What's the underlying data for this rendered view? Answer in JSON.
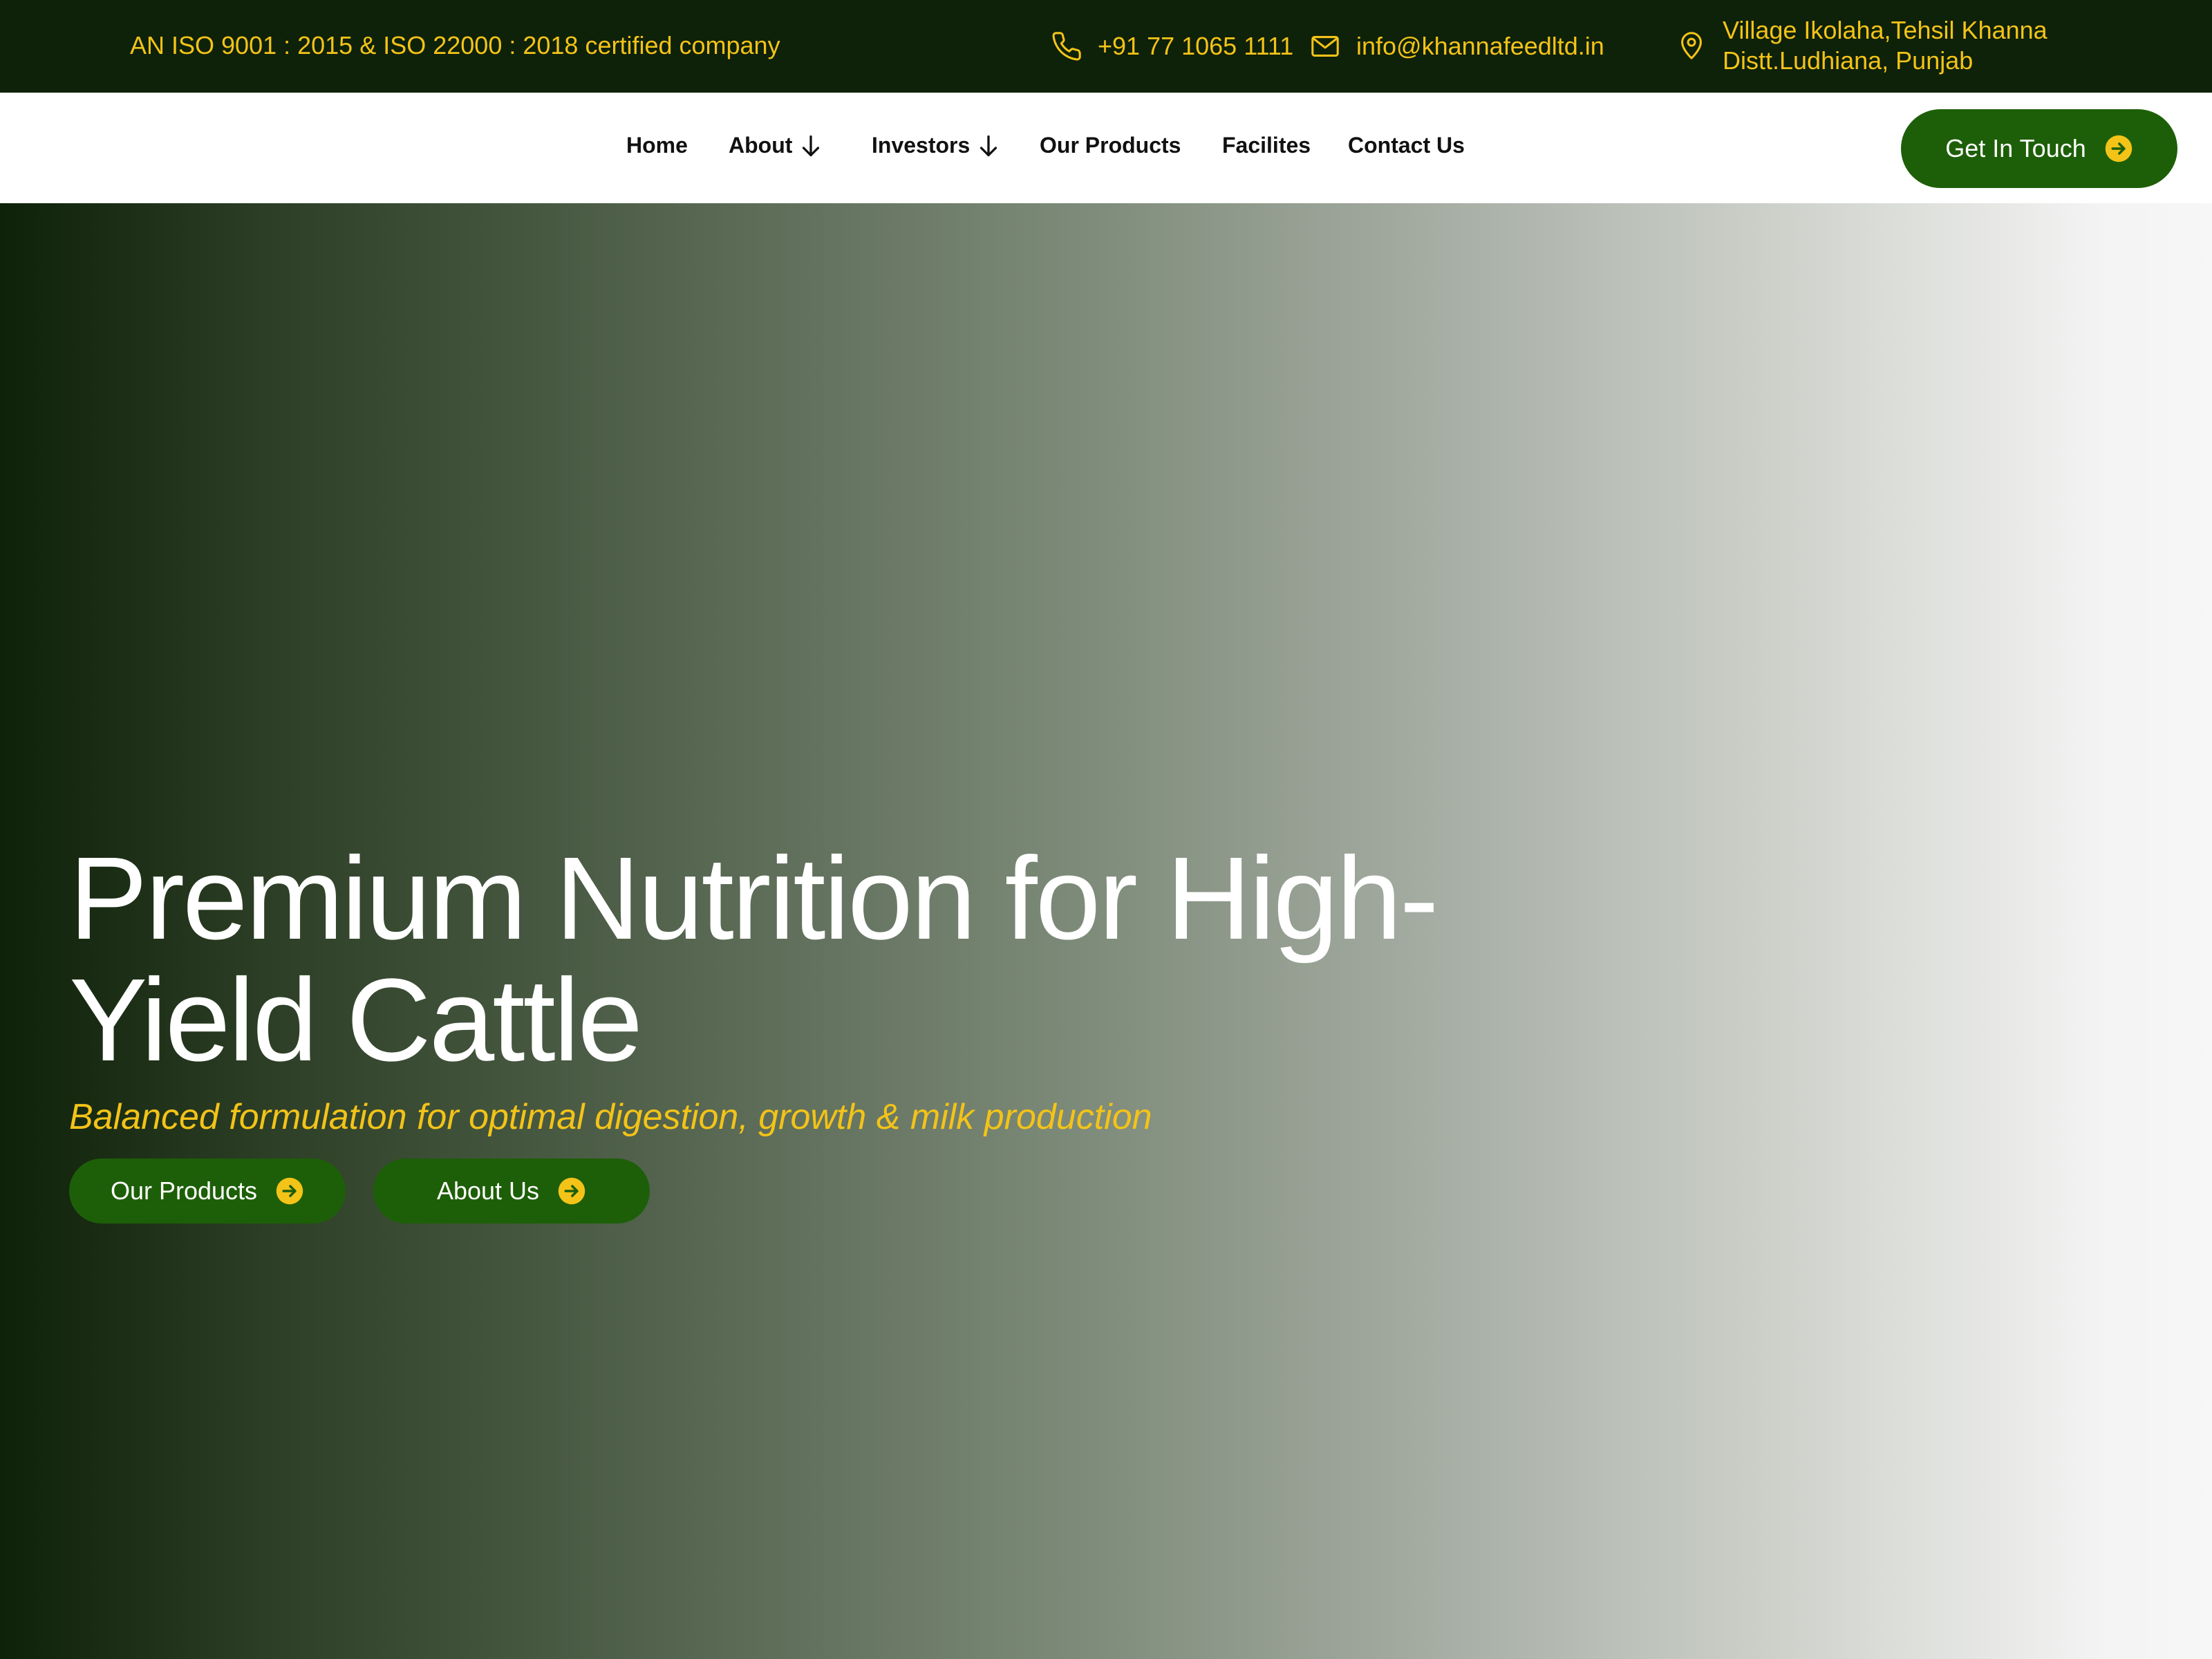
{
  "topbar": {
    "certification": "AN ISO 9001 : 2015 & ISO 22000 : 2018 certified company",
    "phone": "+91 77 1065 1111",
    "email": "info@khannafeedltd.in",
    "address_line1": "Village Ikolaha,Tehsil Khanna",
    "address_line2": "Distt.Ludhiana, Punjab",
    "icons": {
      "phone": "phone-icon",
      "email": "mail-icon",
      "address": "map-pin-icon"
    }
  },
  "nav": {
    "items": [
      {
        "label": "Home"
      },
      {
        "label": "About",
        "has_dropdown": true
      },
      {
        "label": "Investors",
        "has_dropdown": true
      },
      {
        "label": "Our Products"
      },
      {
        "label": "Facilites"
      },
      {
        "label": "Contact Us"
      }
    ],
    "cta_label": "Get In Touch"
  },
  "hero": {
    "title": "Premium Nutrition for High-Yield Cattle",
    "subtitle": "Balanced formulation for optimal digestion, growth & milk production",
    "buttons": [
      {
        "label": "Our Products"
      },
      {
        "label": "About Us"
      }
    ]
  },
  "colors": {
    "dark_green": "#0e2109",
    "brand_green": "#1d5f08",
    "accent_yellow": "#f3c318",
    "white": "#ffffff"
  }
}
